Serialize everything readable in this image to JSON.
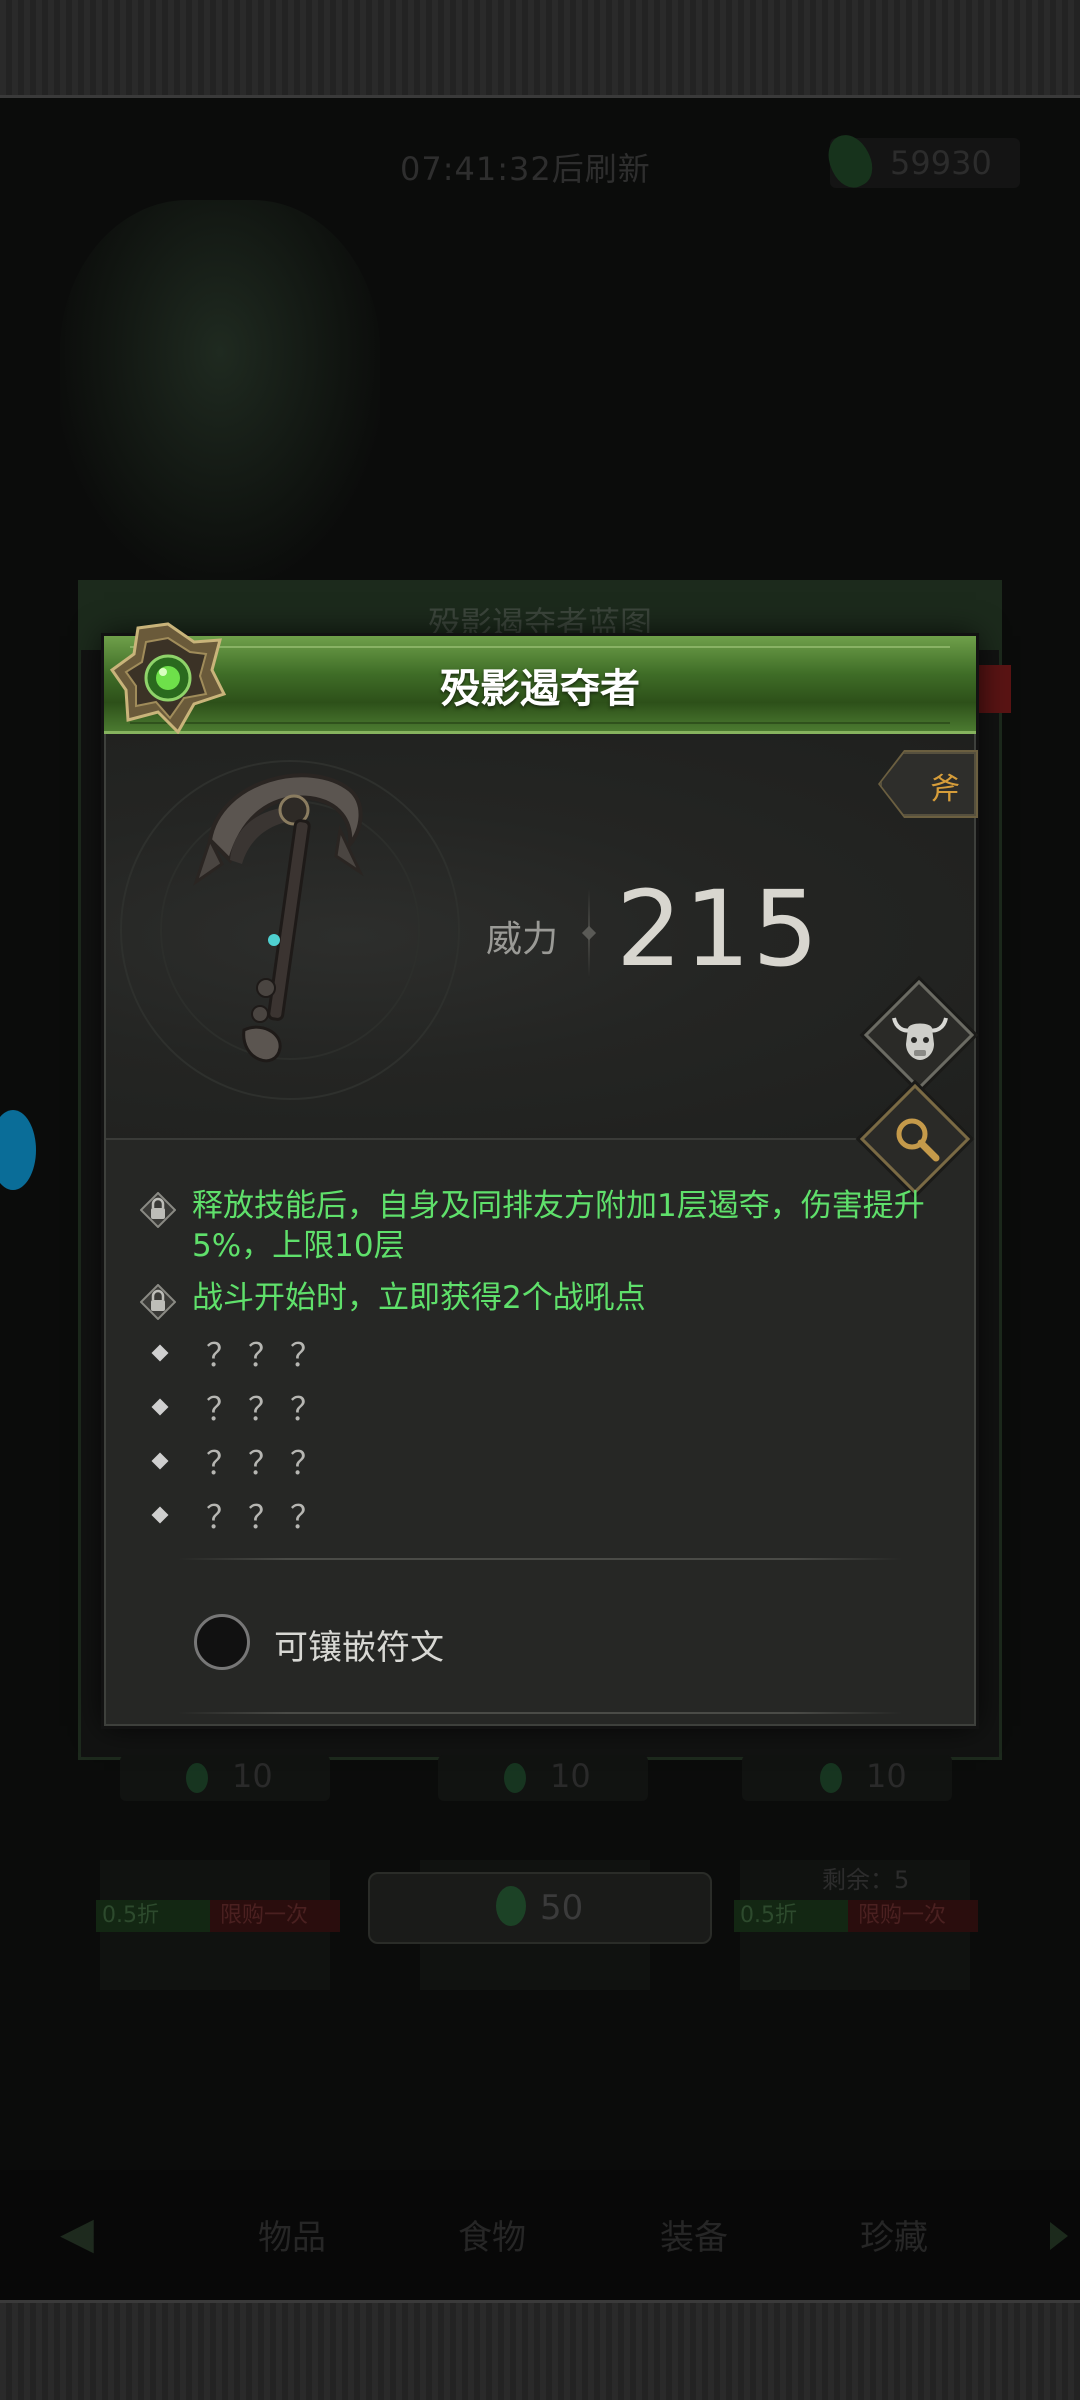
{
  "background": {
    "refresh_text": "07:41:32后刷新",
    "currency_value": "59930",
    "panel_title": "殁影遏夺者蓝图",
    "slot_prices": [
      "10",
      "10",
      "10"
    ],
    "buy_price": "50",
    "remaining": "剩余：5",
    "discount_tag": "0.5折",
    "limit_tag": "限购一次",
    "tabs": [
      "物品",
      "食物",
      "装备",
      "珍藏"
    ]
  },
  "dialog": {
    "title": "殁影遏夺者",
    "weapon_type": "斧",
    "power_label": "威力",
    "power_value": "215",
    "traits": [
      "释放技能后，自身及同排友方附加1层遏夺，伤害提升5%，上限10层",
      "战斗开始时，立即获得2个战吼点"
    ],
    "unknown_traits": [
      "？？？",
      "？？？",
      "？？？",
      "？？？"
    ],
    "socket_label": "可镶嵌符文"
  },
  "colors": {
    "header_green": "#3f6d27",
    "trait_green": "#5fe06b",
    "type_orange": "#d69d3a",
    "panel_bg": "#262725"
  },
  "icons": {
    "emblem": "green-gem-emblem-icon",
    "weapon": "scythe-axe-icon",
    "bull": "bull-skull-icon",
    "magnifier": "magnifier-icon",
    "lock": "lock-icon"
  }
}
